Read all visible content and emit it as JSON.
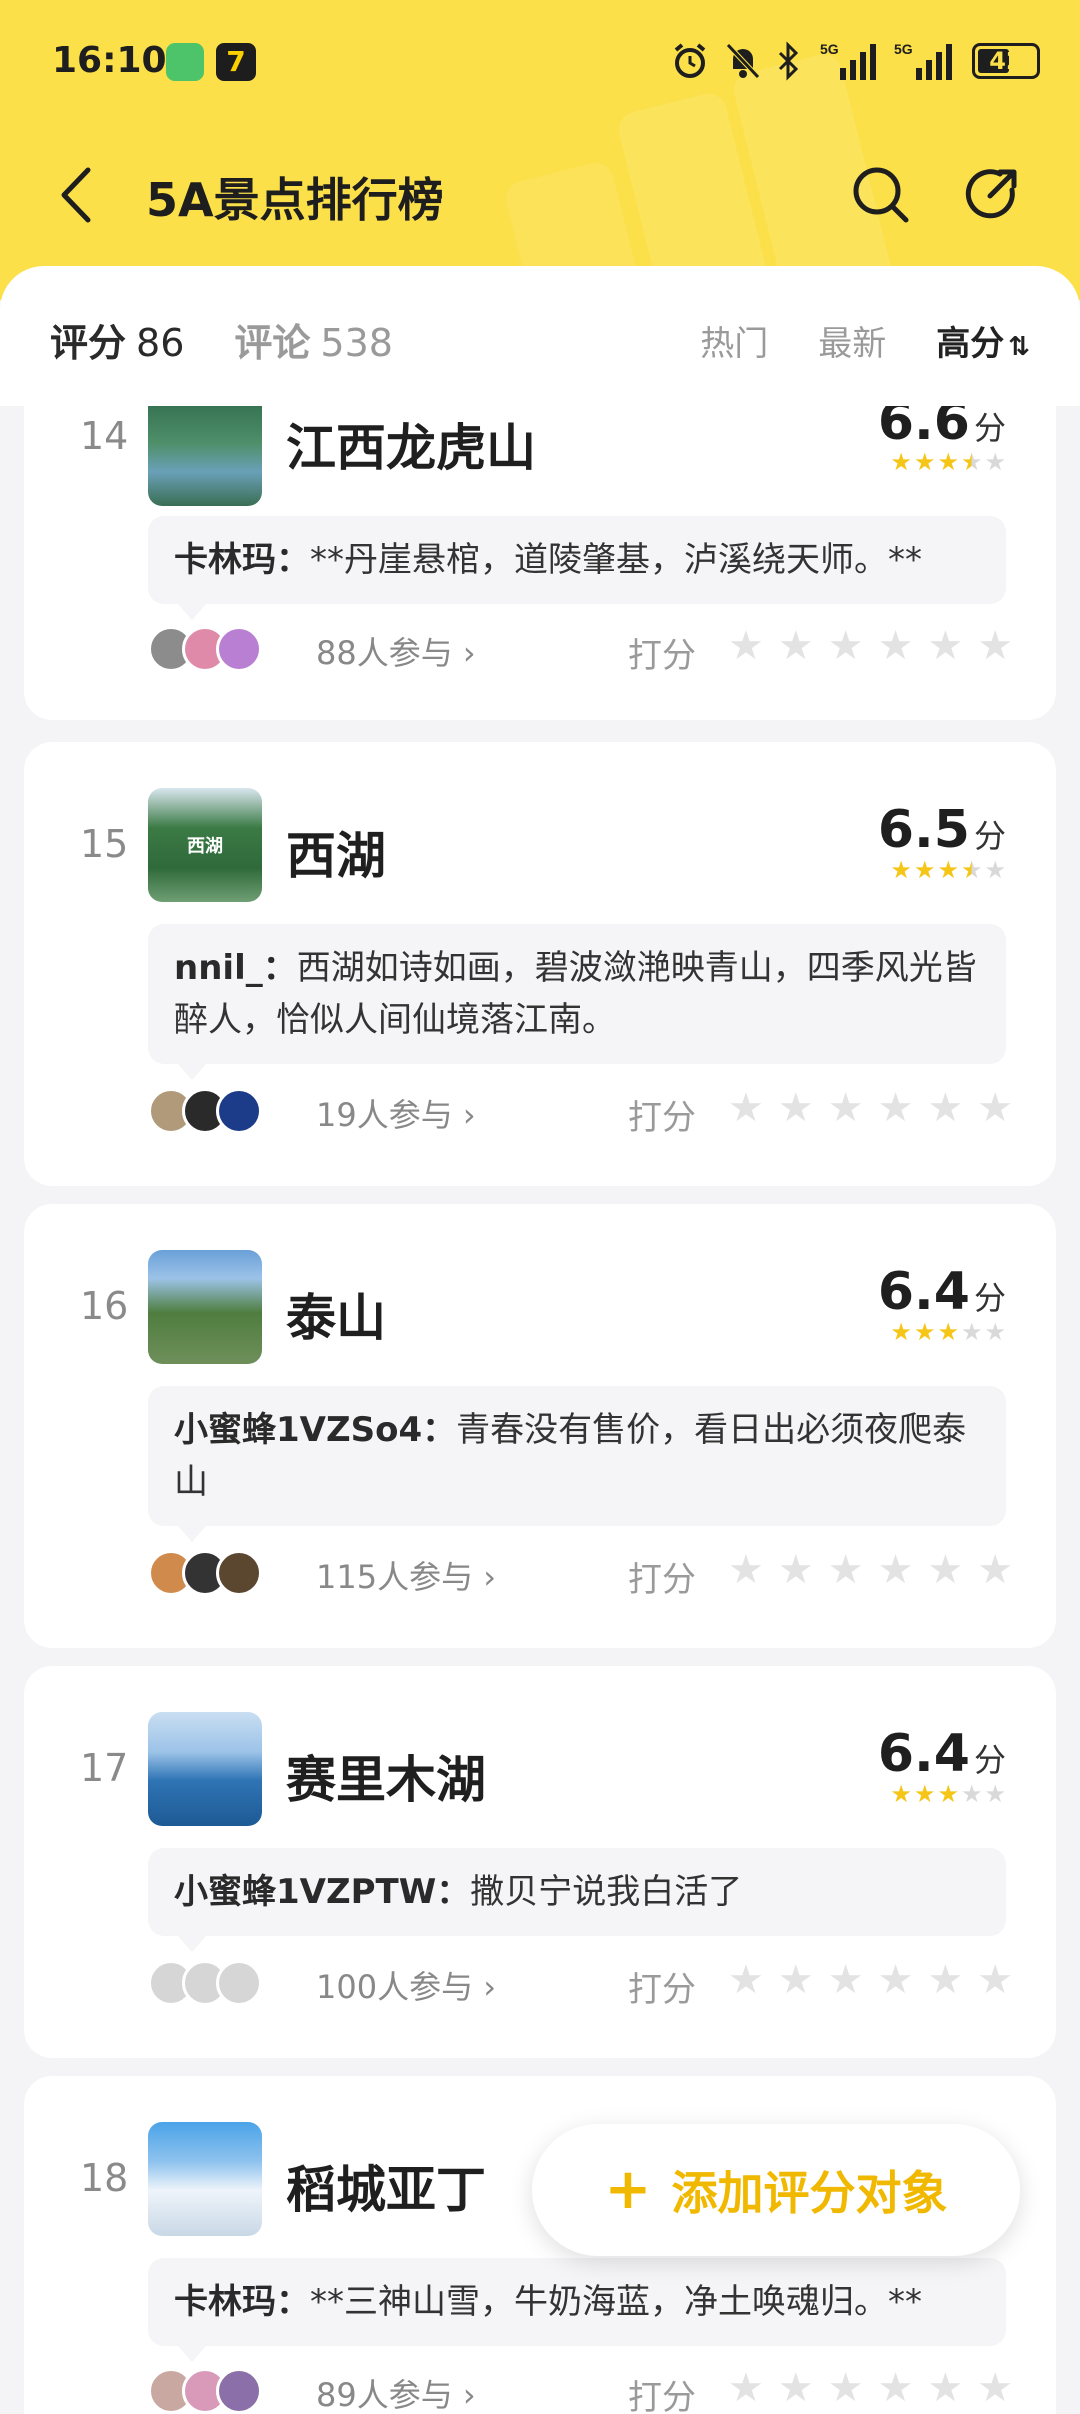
{
  "status": {
    "time": "16:10",
    "app2": "7",
    "network": "5G",
    "battery": "42"
  },
  "nav": {
    "title": "5A景点排行榜"
  },
  "tabs": [
    {
      "label": "评分",
      "count": "86"
    },
    {
      "label": "评论",
      "count": "538"
    }
  ],
  "sort": {
    "hot": "热门",
    "latest": "最新",
    "high": "高分",
    "high_icon": "⇅"
  },
  "rate_label": "打分",
  "items": [
    {
      "rank": "14",
      "name": "江西龙虎山",
      "score": "6.6",
      "unit": "分",
      "stars": 3.5,
      "author": "卡林玛：",
      "comment": "**丹崖悬棺，道陵肇基，泸溪绕天师。**",
      "participants": "88人参与 ›",
      "thumb_colors": [
        "#3e7a5b",
        "#6aa0b8"
      ],
      "avatars": [
        "#8c8c8c",
        "#e08aa9",
        "#b97fd3"
      ]
    },
    {
      "rank": "15",
      "name": "西湖",
      "score": "6.5",
      "unit": "分",
      "stars": 3.5,
      "author": "nnil_：",
      "comment": "西湖如诗如画，碧波潋滟映青山，四季风光皆醉人，恰似人间仙境落江南。",
      "participants": "19人参与 ›",
      "thumb_colors": [
        "#2f6a3b",
        "#6f9f74"
      ],
      "thumb_text": "西湖",
      "avatars": [
        "#b09a7a",
        "#2a2a2a",
        "#1c3c8a"
      ]
    },
    {
      "rank": "16",
      "name": "泰山",
      "score": "6.4",
      "unit": "分",
      "stars": 3,
      "author": "小蜜蜂1VZSo4：",
      "comment": "青春没有售价，看日出必须夜爬泰山",
      "participants": "115人参与 ›",
      "thumb_colors": [
        "#6aa0d8",
        "#4f7d3f"
      ],
      "avatars": [
        "#d08b4c",
        "#333333",
        "#5b4630"
      ]
    },
    {
      "rank": "17",
      "name": "赛里木湖",
      "score": "6.4",
      "unit": "分",
      "stars": 3,
      "author": "小蜜蜂1VZPTW：",
      "comment": "撒贝宁说我白活了",
      "participants": "100人参与 ›",
      "thumb_colors": [
        "#9cc3e8",
        "#2f74b5"
      ],
      "avatars": [
        "#d6d6d6",
        "#d6d6d6",
        "#d6d6d6"
      ]
    },
    {
      "rank": "18",
      "name": "稻城亚丁",
      "score": "",
      "unit": "",
      "stars": 0,
      "author": "卡林玛：",
      "comment": "**三神山雪，牛奶海蓝，净土唤魂归。**",
      "participants": "89人参与 ›",
      "thumb_colors": [
        "#4aa3e8",
        "#eef4fa"
      ],
      "avatars": [
        "#c8a8a0",
        "#d89ab8",
        "#8a6fa8"
      ]
    }
  ],
  "fab": {
    "plus": "+",
    "label": "添加评分对象"
  }
}
